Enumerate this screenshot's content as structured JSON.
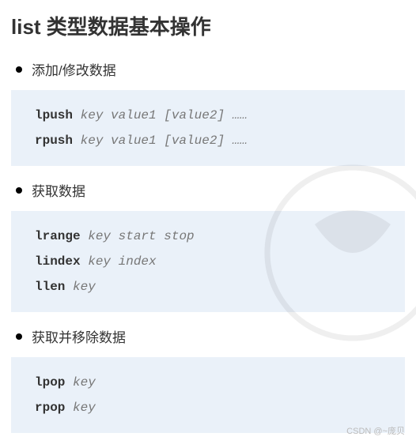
{
  "title": "list 类型数据基本操作",
  "sections": [
    {
      "label": "添加/修改数据",
      "commands": [
        {
          "cmd": "lpush",
          "args": "key value1 [value2] ……"
        },
        {
          "cmd": "rpush",
          "args": "key value1 [value2] ……"
        }
      ]
    },
    {
      "label": "获取数据",
      "commands": [
        {
          "cmd": "lrange",
          "args": "key start stop"
        },
        {
          "cmd": "lindex",
          "args": "key index"
        },
        {
          "cmd": "llen",
          "args": "key"
        }
      ]
    },
    {
      "label": "获取并移除数据",
      "commands": [
        {
          "cmd": "lpop",
          "args": "key"
        },
        {
          "cmd": "rpop",
          "args": "key"
        }
      ]
    }
  ],
  "footer_watermark": "CSDN @~庞贝"
}
